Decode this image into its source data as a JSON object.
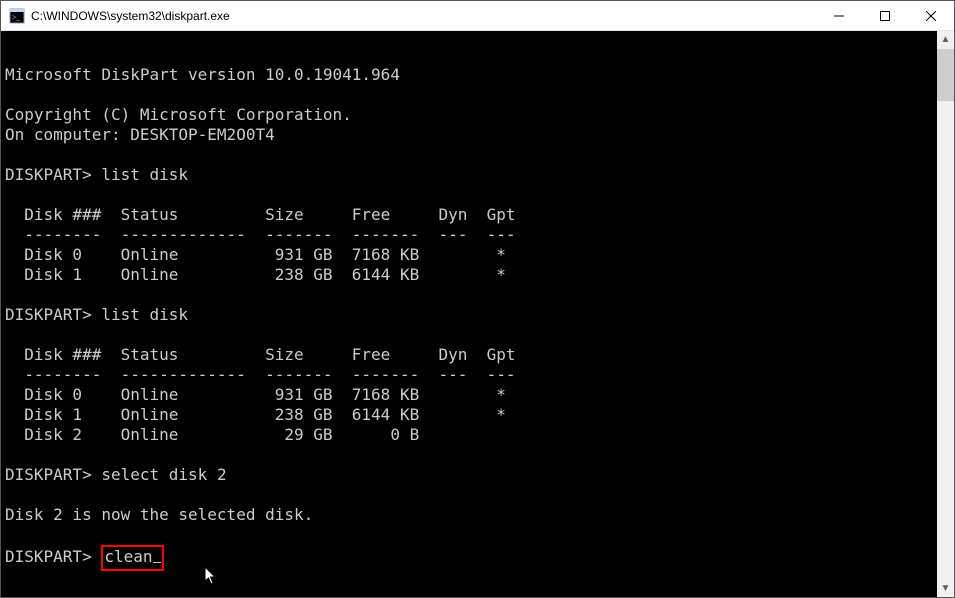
{
  "window": {
    "title": "C:\\WINDOWS\\system32\\diskpart.exe"
  },
  "terminal": {
    "version_line": "Microsoft DiskPart version 10.0.19041.964",
    "copyright_line": "Copyright (C) Microsoft Corporation.",
    "computer_line": "On computer: DESKTOP-EM2O0T4",
    "prompt": "DISKPART>",
    "cmd_list_disk": "list disk",
    "cmd_select_disk": "select disk 2",
    "cmd_clean": "clean",
    "select_response": "Disk 2 is now the selected disk.",
    "table1": {
      "header": "  Disk ###  Status         Size     Free     Dyn  Gpt",
      "divider": "  --------  -------------  -------  -------  ---  ---",
      "rows": [
        "  Disk 0    Online          931 GB  7168 KB        *",
        "  Disk 1    Online          238 GB  6144 KB        *"
      ]
    },
    "table2": {
      "header": "  Disk ###  Status         Size     Free     Dyn  Gpt",
      "divider": "  --------  -------------  -------  -------  ---  ---",
      "rows": [
        "  Disk 0    Online          931 GB  7168 KB        *",
        "  Disk 1    Online          238 GB  6144 KB        *",
        "  Disk 2    Online           29 GB      0 B"
      ]
    }
  }
}
